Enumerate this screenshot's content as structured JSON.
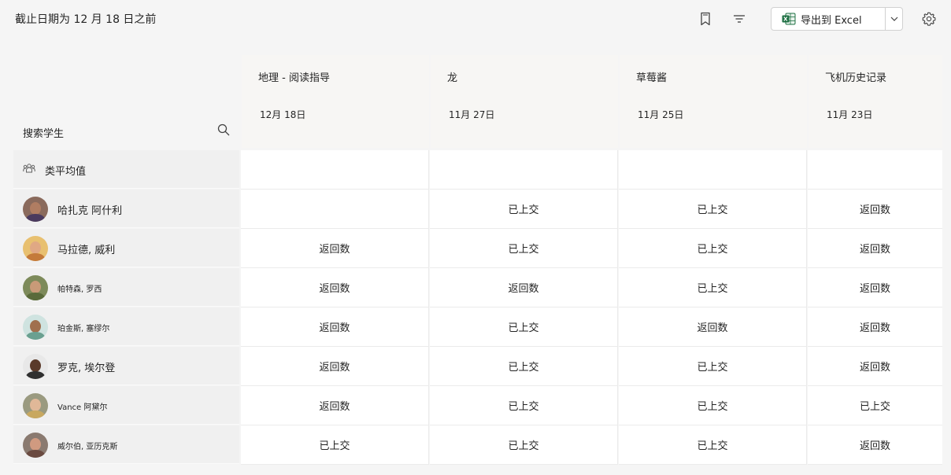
{
  "header": {
    "title": "截止日期为 12 月 18 日之前",
    "export_label": "导出到 Excel"
  },
  "search": {
    "label": "搜索学生"
  },
  "class_average": {
    "label": "类平均值"
  },
  "assignments": [
    {
      "title": "地理 - 阅读指导",
      "date": "12月 18日"
    },
    {
      "title": "龙",
      "date": "11月 27日"
    },
    {
      "title": "草莓酱",
      "date": "11月 25日"
    },
    {
      "title": "飞机历史记录",
      "date": "11月 23日"
    }
  ],
  "students": [
    {
      "name": "哈扎克 阿什利",
      "statuses": [
        "",
        "已上交",
        "已上交",
        "返回数"
      ]
    },
    {
      "name": "马拉德, 威利",
      "statuses": [
        "返回数",
        "已上交",
        "已上交",
        "返回数"
      ]
    },
    {
      "name": "帕特森, 罗西",
      "statuses": [
        "返回数",
        "返回数",
        "已上交",
        "返回数"
      ]
    },
    {
      "name": "珀金斯, 塞缪尔",
      "statuses": [
        "返回数",
        "已上交",
        "返回数",
        "返回数"
      ]
    },
    {
      "name": "罗克, 埃尔登",
      "statuses": [
        "返回数",
        "已上交",
        "已上交",
        "返回数"
      ]
    },
    {
      "name": "Vance 阿黛尔",
      "statuses": [
        "返回数",
        "已上交",
        "已上交",
        "已上交"
      ]
    },
    {
      "name": "威尔伯, 亚历克斯",
      "statuses": [
        "已上交",
        "已上交",
        "已上交",
        "返回数"
      ]
    }
  ],
  "colors": {
    "excel_green": "#1d6f42",
    "header_bg": "#f7f6f4",
    "row_label_bg": "#f0f0f0"
  },
  "icons": [
    "bookmark-icon",
    "filter-icon",
    "excel-icon",
    "chevron-down-icon",
    "settings-icon",
    "search-icon",
    "people-icon"
  ]
}
